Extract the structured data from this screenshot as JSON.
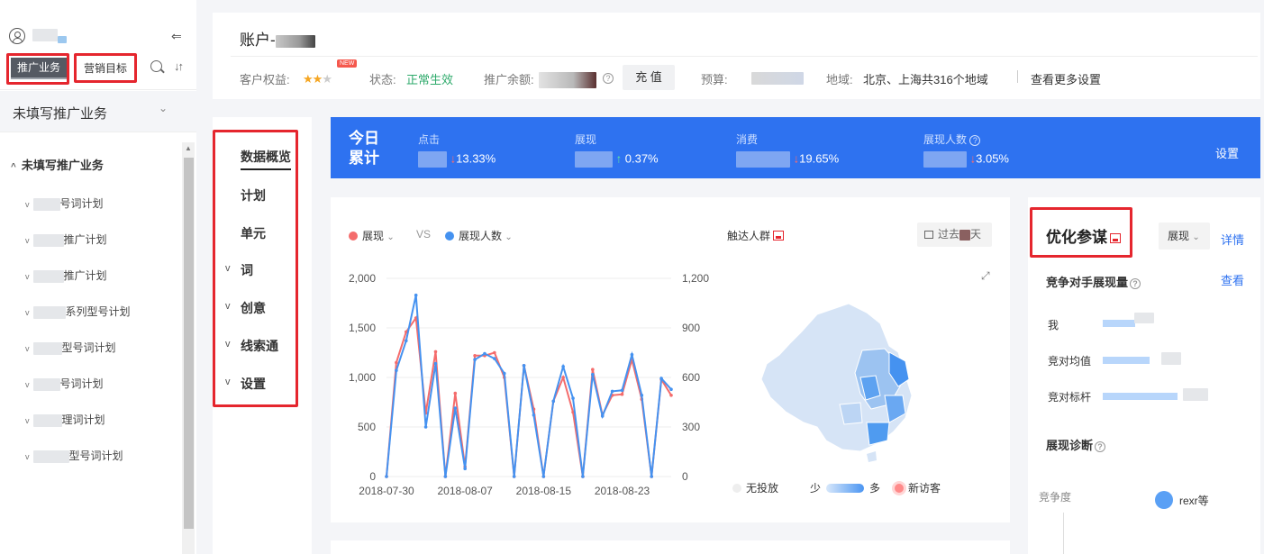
{
  "sidebar": {
    "tab_business": "推广业务",
    "tab_goal": "营销目标",
    "business_select": "未填写推广业务",
    "tree_root": "未填写推广业务",
    "plans": [
      "号词计划",
      "推广计划",
      "推广计划",
      "系列型号计划",
      "型号词计划",
      "号词计划",
      "理词计划",
      "型号词计划"
    ]
  },
  "header": {
    "account_label": "账户-",
    "rights_label": "客户权益:",
    "new_badge": "NEW",
    "status_label": "状态:",
    "status_value": "正常生效",
    "balance_label": "推广余额:",
    "recharge_button": "充 值",
    "budget_label": "预算:",
    "region_label": "地域:",
    "region_value": "北京、上海共316个地域",
    "more_settings": "查看更多设置"
  },
  "nav": {
    "items": [
      "数据概览",
      "计划",
      "单元",
      "词",
      "创意",
      "线索通",
      "设置"
    ]
  },
  "today": {
    "title_line1": "今日",
    "title_line2": "累计",
    "metrics": [
      {
        "label": "点击",
        "change": "13.33%",
        "direction": "down"
      },
      {
        "label": "展现",
        "change": "0.37%",
        "direction": "up"
      },
      {
        "label": "消费",
        "change": "19.65%",
        "direction": "down"
      },
      {
        "label": "展现人数",
        "change": "3.05%",
        "direction": "down"
      }
    ],
    "settings": "设置"
  },
  "chart_panel": {
    "legend_a": "展现",
    "vs": "VS",
    "legend_b": "展现人数",
    "reach": "触达人群",
    "date_button": "过去",
    "date_suffix": "天",
    "map_none": "无投放",
    "map_less": "少",
    "map_more": "多",
    "map_new": "新访客",
    "color_a": "#f46c6c",
    "color_b": "#4592f0"
  },
  "chart_data": {
    "type": "line",
    "x_ticks": [
      "2018-07-30",
      "2018-08-07",
      "2018-08-15",
      "2018-08-23"
    ],
    "y_left_ticks": [
      "0",
      "500",
      "1,000",
      "1,500",
      "2,000"
    ],
    "y_right_ticks": [
      "0",
      "300",
      "600",
      "900",
      "1,200"
    ],
    "ylim_left": [
      0,
      2000
    ],
    "ylim_right": [
      0,
      1200
    ],
    "series": [
      {
        "name": "展现",
        "axis": "left",
        "color": "#f46c6c",
        "values": [
          0,
          1150,
          1460,
          1600,
          640,
          1260,
          0,
          840,
          100,
          1220,
          1220,
          1250,
          1000,
          0,
          1120,
          680,
          0,
          760,
          1000,
          650,
          0,
          1080,
          620,
          820,
          830,
          1180,
          780,
          0,
          980,
          820
        ]
      },
      {
        "name": "展现人数",
        "axis": "right",
        "color": "#4592f0",
        "values": [
          0,
          642,
          822,
          1098,
          300,
          684,
          0,
          414,
          48,
          708,
          744,
          714,
          624,
          0,
          672,
          372,
          0,
          456,
          666,
          474,
          0,
          618,
          366,
          516,
          522,
          738,
          492,
          0,
          594,
          528
        ]
      }
    ]
  },
  "optimize": {
    "title": "优化参谋",
    "select": "展现",
    "details": "详情",
    "competitor_title": "竞争对手展现量",
    "view": "查看",
    "rows": [
      {
        "label": "我",
        "value": 0.28
      },
      {
        "label": "竞对均值",
        "value": 0.4
      },
      {
        "label": "竞对标杆",
        "value": 0.64
      }
    ],
    "diagnose_title": "展现诊断",
    "axis_label": "竞争度",
    "point_label": "rexr等"
  }
}
